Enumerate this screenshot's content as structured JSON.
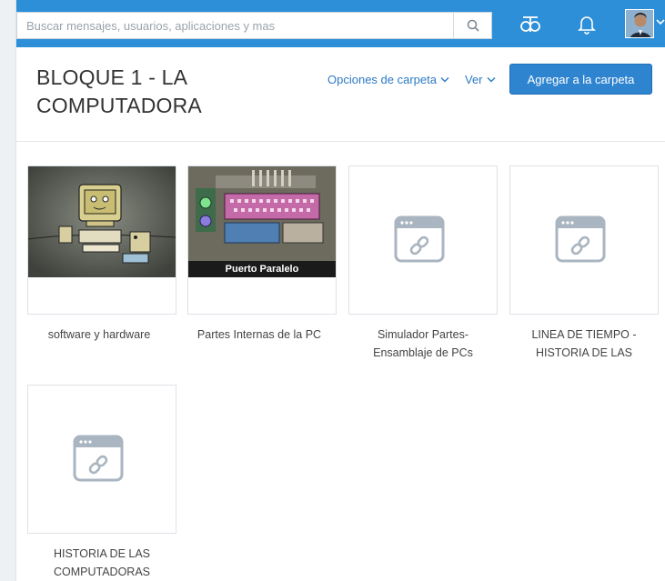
{
  "search": {
    "placeholder": "Buscar mensajes, usuarios, aplicaciones y mas"
  },
  "topbar": {
    "icons": [
      "search-icon",
      "apps-hub-icon",
      "bell-icon",
      "user-avatar",
      "chevron-down-icon"
    ],
    "color": "#2c8fd8"
  },
  "folder": {
    "title_line1": "BLOQUE 1 - LA",
    "title_line2": "COMPUTADORA",
    "options_label": "Opciones de carpeta",
    "view_label": "Ver",
    "add_button_label": "Agregar a la carpeta"
  },
  "thumbnail_caption": "Puerto Paralelo",
  "items": [
    {
      "label_line1": "software y hardware",
      "label_line2": "",
      "thumb": "image"
    },
    {
      "label_line1": "Partes Internas de la PC",
      "label_line2": "",
      "thumb": "image"
    },
    {
      "label_line1": "Simulador Partes-",
      "label_line2": "Ensamblaje de PCs",
      "thumb": "link-icon"
    },
    {
      "label_line1": "LINEA DE TIEMPO -",
      "label_line2": "HISTORIA DE LAS",
      "thumb": "link-icon"
    },
    {
      "label_line1": "HISTORIA DE LAS",
      "label_line2": "COMPUTADORAS",
      "thumb": "link-icon"
    }
  ]
}
